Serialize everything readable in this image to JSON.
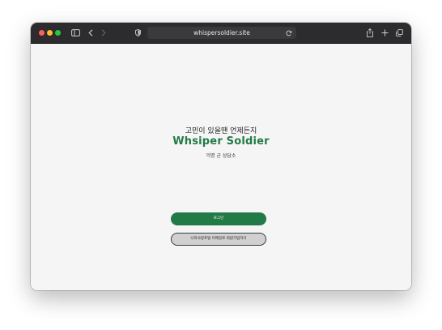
{
  "browser": {
    "url": "whispersoldier.site",
    "icons": {
      "close": "close-dot",
      "minimize": "minimize-dot",
      "zoom": "zoom-dot",
      "sidebar": "sidebar-icon",
      "back": "chevron-left-icon",
      "forward": "chevron-right-icon",
      "privacy": "shield-icon",
      "reload": "reload-icon",
      "share": "share-icon",
      "new_tab": "plus-icon",
      "tabs": "tabs-overview-icon"
    },
    "colors": {
      "toolbar": "#2c2c2e",
      "address_bar": "#3a3a3c"
    }
  },
  "page": {
    "tagline": "고민이 있을땐 언제든지",
    "brand": "Whsiper Soldier",
    "subtitle": "익명 군 상담소",
    "login_label": "로그인",
    "signup_label": "나라사랑포털 이메일로 회원가입하기",
    "colors": {
      "brand": "#227a47",
      "background": "#f5f5f5",
      "secondary_button": "#d0d0d0"
    }
  }
}
